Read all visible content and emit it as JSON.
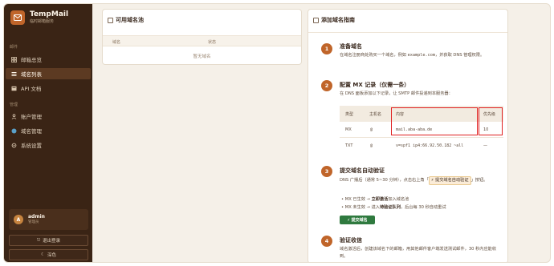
{
  "brand": {
    "name": "TempMail",
    "subtitle": "临时邮箱服务"
  },
  "sidebar": {
    "section_mail": "邮件",
    "section_manage": "管理",
    "items": [
      {
        "label": "邮箱总览",
        "icon": "grid-icon"
      },
      {
        "label": "域名列表",
        "icon": "list-icon",
        "active": true
      },
      {
        "label": "API 文档",
        "icon": "doc-icon"
      },
      {
        "label": "账户管理",
        "icon": "user-icon"
      },
      {
        "label": "域名管理",
        "icon": "globe-icon"
      },
      {
        "label": "系统设置",
        "icon": "gear-icon"
      }
    ],
    "user": {
      "initial": "A",
      "name": "admin",
      "role": "管理员"
    },
    "logout_label": "退出登录",
    "theme_label": "深色"
  },
  "pool": {
    "title": "可用域名池",
    "columns": [
      "域名",
      "状态"
    ],
    "empty_text": "暂无域名"
  },
  "guide": {
    "title": "添加域名指南",
    "steps": [
      {
        "num": "1",
        "title": "准备域名",
        "desc_prefix": "在域名注册商处购买一个域名，例如 ",
        "desc_code": "example.com",
        "desc_suffix": "，并获取 DNS 管理权限。"
      },
      {
        "num": "2",
        "title": "配置 MX 记录（仅需一条）",
        "desc": "在 DNS 面板添加以下记录，让 SMTP 邮件投递到本服务器：",
        "table": {
          "headers": [
            "类型",
            "主机名",
            "内容",
            "优先级"
          ],
          "rows": [
            [
              "MX",
              "@",
              "mail.aba-aba.de",
              "10"
            ],
            [
              "TXT",
              "@",
              "v=spf1 ip4:66.92.50.182 ~all",
              "—"
            ]
          ]
        }
      },
      {
        "num": "3",
        "title": "提交域名自动验证",
        "desc_prefix": "DNS 广播后（通常 5~30 分钟），点击右上角「",
        "desc_tag": "⚡ 提交域名自动验证",
        "desc_suffix": "」按钮。",
        "bullets": [
          {
            "pre": "MX 已生效 → ",
            "bold": "立即激活",
            "post": "加入域名池"
          },
          {
            "pre": "MX 未生效 → 进入",
            "bold": "待验证队列",
            "post": "，后台每 30 秒自动重试"
          }
        ],
        "button_label": "⚡ 提交域名"
      },
      {
        "num": "4",
        "title": "验证收信",
        "desc": "域名激活后，创建该域名下的邮箱，用其他邮件客户端发送测试邮件，30 秒内应能收到。"
      }
    ]
  },
  "colors": {
    "sidebar_bg": "#3a2415",
    "accent": "#c0652a",
    "highlight_box": "#e02020",
    "submit_green": "#2f7a3f"
  }
}
